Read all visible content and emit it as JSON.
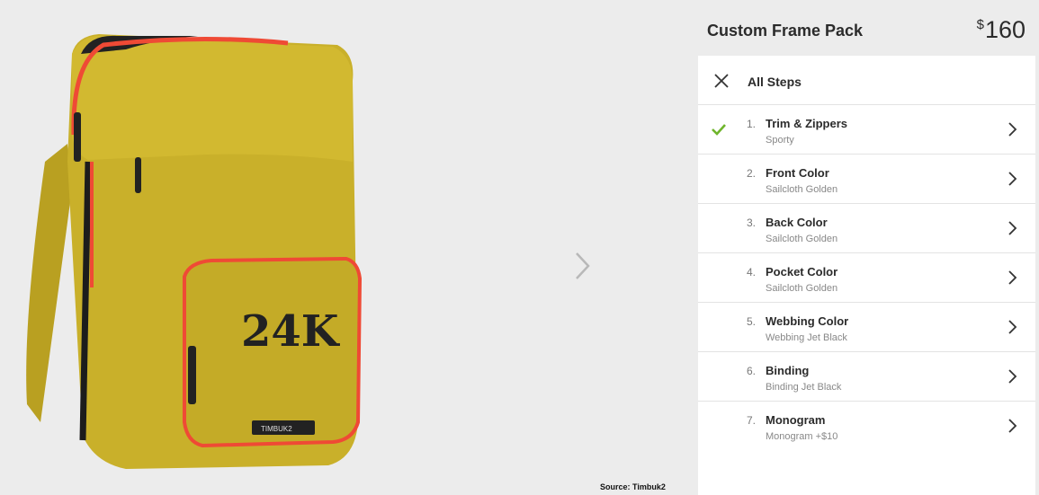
{
  "header": {
    "product_name": "Custom Frame Pack",
    "price_currency": "$",
    "price_amount": "160"
  },
  "panel": {
    "title": "All Steps"
  },
  "steps": [
    {
      "num": "1.",
      "title": "Trim & Zippers",
      "value": "Sporty",
      "completed": true
    },
    {
      "num": "2.",
      "title": "Front Color",
      "value": "Sailcloth Golden",
      "completed": false
    },
    {
      "num": "3.",
      "title": "Back Color",
      "value": "Sailcloth Golden",
      "completed": false
    },
    {
      "num": "4.",
      "title": "Pocket Color",
      "value": "Sailcloth Golden",
      "completed": false
    },
    {
      "num": "5.",
      "title": "Webbing Color",
      "value": "Webbing Jet Black",
      "completed": false
    },
    {
      "num": "6.",
      "title": "Binding",
      "value": "Binding Jet Black",
      "completed": false
    },
    {
      "num": "7.",
      "title": "Monogram",
      "value": "Monogram +$10",
      "completed": false
    }
  ],
  "product_image": {
    "monogram_text": "24K",
    "brand_label": "TIMBUK2",
    "body_color": "#c9b02a",
    "zipper_color": "#ef4a35",
    "binding_color": "#1c1c1c"
  },
  "source_note": "Source: Timbuk2",
  "icons": {
    "close": "close-icon",
    "check": "checkmark-icon",
    "chevron": "chevron-right-icon",
    "next": "next-arrow-icon"
  },
  "colors": {
    "check_green": "#6fb52c",
    "panel_bg": "#ffffff",
    "page_bg": "#ececec"
  }
}
